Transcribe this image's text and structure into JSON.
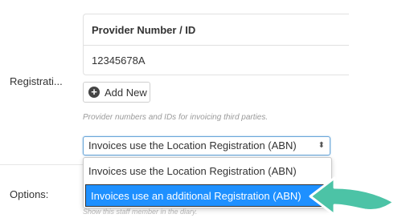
{
  "form": {
    "registration_label": "Registrati...",
    "options_label": "Options:",
    "provider_table": {
      "header": "Provider Number / ID",
      "rows": [
        "12345678A"
      ]
    },
    "add_new_label": "Add New",
    "help_text": "Provider numbers and IDs for invoicing third parties.",
    "options_help_text": "Show this staff member in the diary."
  },
  "registration_select": {
    "selected_value": "Invoices use the Location Registration (ABN)",
    "options": [
      "Invoices use the Location Registration (ABN)",
      "Invoices use an additional Registration (ABN)"
    ],
    "highlighted_index": 1
  },
  "icons": {
    "add": "plus-circle-icon",
    "select_toggle": "chevron-updown-icon",
    "annotation": "arrow-pointer-icon"
  },
  "colors": {
    "highlight": "#1e90ff",
    "focus_border": "#6aa6d9",
    "annotation_arrow": "#4cc3a6"
  }
}
